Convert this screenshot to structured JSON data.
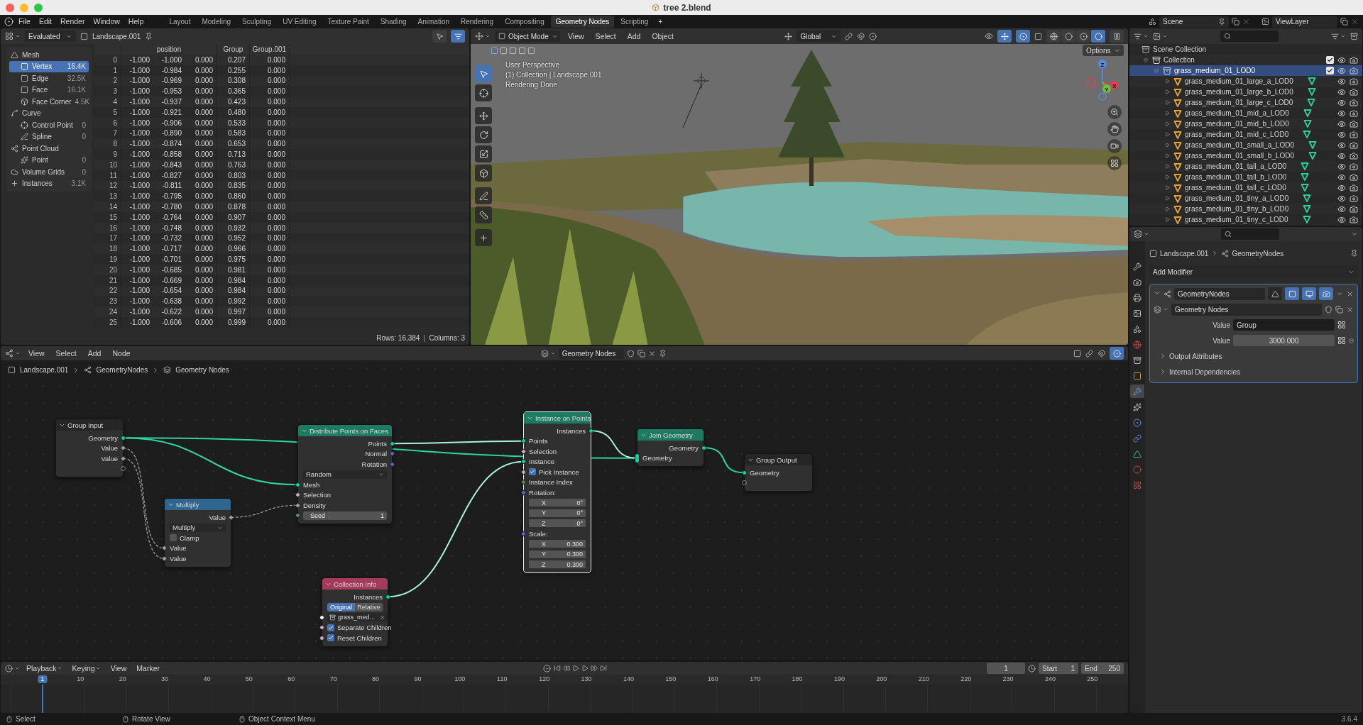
{
  "window": {
    "title": "tree 2.blend"
  },
  "menu": [
    "File",
    "Edit",
    "Render",
    "Window",
    "Help"
  ],
  "workspaces": [
    {
      "label": "Layout",
      "selected": false
    },
    {
      "label": "Modeling",
      "selected": false
    },
    {
      "label": "Sculpting",
      "selected": false
    },
    {
      "label": "UV Editing",
      "selected": false
    },
    {
      "label": "Texture Paint",
      "selected": false
    },
    {
      "label": "Shading",
      "selected": false
    },
    {
      "label": "Animation",
      "selected": false
    },
    {
      "label": "Rendering",
      "selected": false
    },
    {
      "label": "Compositing",
      "selected": false
    },
    {
      "label": "Geometry Nodes",
      "selected": true
    },
    {
      "label": "Scripting",
      "selected": false
    }
  ],
  "add_workspace": "+",
  "scene": "Scene",
  "view_layer": "ViewLayer",
  "spreadsheet": {
    "mode": "Evaluated",
    "object": "Landscape.001",
    "domains": [
      {
        "label": "Mesh",
        "kind": "mesh",
        "children": [
          {
            "label": "Vertex",
            "count": "16.4K",
            "kind": "vertex",
            "selected": true
          },
          {
            "label": "Edge",
            "count": "32.5K",
            "kind": "edge",
            "selected": false
          },
          {
            "label": "Face",
            "count": "16.1K",
            "kind": "face",
            "selected": false
          },
          {
            "label": "Face Corner",
            "count": "4.5K",
            "kind": "corner",
            "selected": false
          }
        ]
      },
      {
        "label": "Curve",
        "kind": "curve",
        "children": [
          {
            "label": "Control Point",
            "count": "0",
            "kind": "point",
            "selected": false
          },
          {
            "label": "Spline",
            "count": "0",
            "kind": "spline",
            "selected": false
          }
        ]
      },
      {
        "label": "Point Cloud",
        "kind": "pointcloud",
        "children": [
          {
            "label": "Point",
            "count": "0",
            "kind": "particle",
            "selected": false
          }
        ]
      },
      {
        "label": "Volume Grids",
        "count": "0",
        "kind": "volume",
        "selected": false
      },
      {
        "label": "Instances",
        "count": "3.1K",
        "kind": "instances",
        "selected": false
      }
    ],
    "columns": [
      {
        "label": "position",
        "kind": "vector"
      },
      {
        "label": "Group",
        "kind": "float"
      },
      {
        "label": "Group.001",
        "kind": "float"
      }
    ],
    "rows": [
      {
        "index": "0",
        "values": [
          [
            "-1.000",
            "-1.000",
            "0.000"
          ],
          "0.207",
          "0.000"
        ]
      },
      {
        "index": "1",
        "values": [
          [
            "-1.000",
            "-0.984",
            "0.000"
          ],
          "0.255",
          "0.000"
        ]
      },
      {
        "index": "2",
        "values": [
          [
            "-1.000",
            "-0.969",
            "0.000"
          ],
          "0.308",
          "0.000"
        ]
      },
      {
        "index": "3",
        "values": [
          [
            "-1.000",
            "-0.953",
            "0.000"
          ],
          "0.365",
          "0.000"
        ]
      },
      {
        "index": "4",
        "values": [
          [
            "-1.000",
            "-0.937",
            "0.000"
          ],
          "0.423",
          "0.000"
        ]
      },
      {
        "index": "5",
        "values": [
          [
            "-1.000",
            "-0.921",
            "0.000"
          ],
          "0.480",
          "0.000"
        ]
      },
      {
        "index": "6",
        "values": [
          [
            "-1.000",
            "-0.906",
            "0.000"
          ],
          "0.533",
          "0.000"
        ]
      },
      {
        "index": "7",
        "values": [
          [
            "-1.000",
            "-0.890",
            "0.000"
          ],
          "0.583",
          "0.000"
        ]
      },
      {
        "index": "8",
        "values": [
          [
            "-1.000",
            "-0.874",
            "0.000"
          ],
          "0.653",
          "0.000"
        ]
      },
      {
        "index": "9",
        "values": [
          [
            "-1.000",
            "-0.858",
            "0.000"
          ],
          "0.713",
          "0.000"
        ]
      },
      {
        "index": "10",
        "values": [
          [
            "-1.000",
            "-0.843",
            "0.000"
          ],
          "0.763",
          "0.000"
        ]
      },
      {
        "index": "11",
        "values": [
          [
            "-1.000",
            "-0.827",
            "0.000"
          ],
          "0.803",
          "0.000"
        ]
      },
      {
        "index": "12",
        "values": [
          [
            "-1.000",
            "-0.811",
            "0.000"
          ],
          "0.835",
          "0.000"
        ]
      },
      {
        "index": "13",
        "values": [
          [
            "-1.000",
            "-0.795",
            "0.000"
          ],
          "0.860",
          "0.000"
        ]
      },
      {
        "index": "14",
        "values": [
          [
            "-1.000",
            "-0.780",
            "0.000"
          ],
          "0.878",
          "0.000"
        ]
      },
      {
        "index": "15",
        "values": [
          [
            "-1.000",
            "-0.764",
            "0.000"
          ],
          "0.907",
          "0.000"
        ]
      },
      {
        "index": "16",
        "values": [
          [
            "-1.000",
            "-0.748",
            "0.000"
          ],
          "0.932",
          "0.000"
        ]
      },
      {
        "index": "17",
        "values": [
          [
            "-1.000",
            "-0.732",
            "0.000"
          ],
          "0.952",
          "0.000"
        ]
      },
      {
        "index": "18",
        "values": [
          [
            "-1.000",
            "-0.717",
            "0.000"
          ],
          "0.966",
          "0.000"
        ]
      },
      {
        "index": "19",
        "values": [
          [
            "-1.000",
            "-0.701",
            "0.000"
          ],
          "0.975",
          "0.000"
        ]
      },
      {
        "index": "20",
        "values": [
          [
            "-1.000",
            "-0.685",
            "0.000"
          ],
          "0.981",
          "0.000"
        ]
      },
      {
        "index": "21",
        "values": [
          [
            "-1.000",
            "-0.669",
            "0.000"
          ],
          "0.984",
          "0.000"
        ]
      },
      {
        "index": "22",
        "values": [
          [
            "-1.000",
            "-0.654",
            "0.000"
          ],
          "0.984",
          "0.000"
        ]
      },
      {
        "index": "23",
        "values": [
          [
            "-1.000",
            "-0.638",
            "0.000"
          ],
          "0.992",
          "0.000"
        ]
      },
      {
        "index": "24",
        "values": [
          [
            "-1.000",
            "-0.622",
            "0.000"
          ],
          "0.997",
          "0.000"
        ]
      },
      {
        "index": "25",
        "values": [
          [
            "-1.000",
            "-0.606",
            "0.000"
          ],
          "0.999",
          "0.000"
        ]
      }
    ],
    "rows_count": "Rows: 16,384",
    "columns_count": "Columns: 3"
  },
  "viewport": {
    "mode": "Object Mode",
    "menus": [
      "View",
      "Select",
      "Add",
      "Object"
    ],
    "orientation": "Global",
    "options": "Options",
    "overlay_text": [
      "User Perspective",
      "(1) Collection | Landscape.001",
      "Rendering Done"
    ],
    "axes": [
      "Z",
      "Y",
      "X"
    ],
    "shading_modes": [
      {
        "selected": false
      },
      {
        "selected": false
      },
      {
        "selected": false
      },
      {
        "selected": true
      }
    ],
    "tools": [
      {
        "selected": true
      },
      {
        "selected": false
      },
      {
        "selected": false
      },
      {
        "selected": false
      },
      {
        "selected": false
      },
      {
        "selected": false
      },
      {
        "selected": false
      },
      {
        "selected": false
      },
      {
        "selected": false
      }
    ]
  },
  "outliner": {
    "tree": [
      {
        "label": "Scene Collection",
        "kind": "scene",
        "selected": false,
        "children": [
          {
            "label": "Collection",
            "kind": "collection",
            "expanded": true,
            "checked": true,
            "selected": false,
            "children": [
              {
                "label": "grass_medium_01_LOD0",
                "kind": "collection",
                "expanded": true,
                "checked": true,
                "selected": true,
                "children": [
                  {
                    "label": "grass_medium_01_large_a_LOD0",
                    "kind": "object",
                    "expanded": false,
                    "selected": false
                  },
                  {
                    "label": "grass_medium_01_large_b_LOD0",
                    "kind": "object",
                    "expanded": false,
                    "selected": false
                  },
                  {
                    "label": "grass_medium_01_large_c_LOD0",
                    "kind": "object",
                    "expanded": false,
                    "selected": false
                  },
                  {
                    "label": "grass_medium_01_mid_a_LOD0",
                    "kind": "object",
                    "expanded": false,
                    "selected": false
                  },
                  {
                    "label": "grass_medium_01_mid_b_LOD0",
                    "kind": "object",
                    "expanded": false,
                    "selected": false
                  },
                  {
                    "label": "grass_medium_01_mid_c_LOD0",
                    "kind": "object",
                    "expanded": false,
                    "selected": false
                  },
                  {
                    "label": "grass_medium_01_small_a_LOD0",
                    "kind": "object",
                    "expanded": false,
                    "selected": false
                  },
                  {
                    "label": "grass_medium_01_small_b_LOD0",
                    "kind": "object",
                    "expanded": false,
                    "selected": false
                  },
                  {
                    "label": "grass_medium_01_tall_a_LOD0",
                    "kind": "object",
                    "expanded": false,
                    "selected": false
                  },
                  {
                    "label": "grass_medium_01_tall_b_LOD0",
                    "kind": "object",
                    "expanded": false,
                    "selected": false
                  },
                  {
                    "label": "grass_medium_01_tall_c_LOD0",
                    "kind": "object",
                    "expanded": false,
                    "selected": false
                  },
                  {
                    "label": "grass_medium_01_tiny_a_LOD0",
                    "kind": "object",
                    "expanded": false,
                    "selected": false
                  },
                  {
                    "label": "grass_medium_01_tiny_b_LOD0",
                    "kind": "object",
                    "expanded": false,
                    "selected": false
                  },
                  {
                    "label": "grass_medium_01_tiny_c_LOD0",
                    "kind": "object",
                    "expanded": false,
                    "selected": false
                  }
                ]
              }
            ]
          }
        ]
      }
    ]
  },
  "properties": {
    "tabs": [
      {
        "selected": false
      },
      {
        "selected": false
      },
      {
        "selected": false
      },
      {
        "selected": false
      },
      {
        "selected": false
      },
      {
        "selected": false
      },
      {
        "selected": false
      },
      {
        "selected": false
      },
      {
        "selected": true
      },
      {
        "selected": false
      },
      {
        "selected": false
      },
      {
        "selected": false
      },
      {
        "selected": false
      },
      {
        "selected": false
      },
      {
        "selected": false
      }
    ],
    "object": "Landscape.001",
    "modifier_path": "GeometryNodes",
    "add_modifier": "Add Modifier",
    "modifier": {
      "name": "GeometryNodes",
      "expanded": true,
      "toggles": [
        {
          "on": false
        },
        {
          "on": true
        },
        {
          "on": true
        },
        {
          "on": true
        }
      ],
      "node_group": "Geometry Nodes",
      "inputs": [
        {
          "label": "Value",
          "value": "Group",
          "kind": "attribute"
        },
        {
          "label": "Value",
          "value": "3000.000",
          "kind": "number"
        }
      ],
      "sections": [
        {
          "label": "Output Attributes",
          "expanded": false
        },
        {
          "label": "Internal Dependencies",
          "expanded": false
        }
      ]
    }
  },
  "node_editor": {
    "menus": [
      "View",
      "Select",
      "Add",
      "Node"
    ],
    "node_group": "Geometry Nodes",
    "breadcrumbs": [
      "Landscape.001",
      "GeometryNodes",
      "Geometry Nodes"
    ],
    "nodes": [
      {
        "title": "Group Input",
        "kind": "group",
        "selected": false,
        "rows": [
          {
            "kind": "output",
            "label": "Geometry",
            "socket": {
              "kind": "geometry"
            }
          },
          {
            "kind": "output",
            "label": "Value",
            "socket": {
              "kind": "float_field"
            }
          },
          {
            "kind": "output",
            "label": "Value",
            "socket": {
              "kind": "float_field"
            }
          },
          {
            "kind": "output_empty",
            "socket": {
              "kind": "virtual"
            }
          }
        ]
      },
      {
        "title": "Multiply",
        "kind": "math",
        "selected": false,
        "rows": [
          {
            "kind": "output",
            "label": "Value",
            "socket": {
              "kind": "float_field"
            }
          },
          {
            "kind": "select",
            "value": "Multiply"
          },
          {
            "kind": "checkbox",
            "label": "Clamp",
            "checked": false
          },
          {
            "kind": "input",
            "label": "Value",
            "socket": {
              "kind": "float_field"
            }
          },
          {
            "kind": "input",
            "label": "Value",
            "socket": {
              "kind": "float_field"
            }
          }
        ]
      },
      {
        "title": "Distribute Points on Faces",
        "kind": "geometry",
        "selected": false,
        "rows": [
          {
            "kind": "output",
            "label": "Points",
            "socket": {
              "kind": "geometry"
            }
          },
          {
            "kind": "output",
            "label": "Normal",
            "socket": {
              "kind": "vector_field"
            }
          },
          {
            "kind": "output",
            "label": "Rotation",
            "socket": {
              "kind": "vector_field"
            }
          },
          {
            "kind": "select",
            "value": "Random"
          },
          {
            "kind": "input",
            "label": "Mesh",
            "socket": {
              "kind": "geometry"
            }
          },
          {
            "kind": "input",
            "label": "Selection",
            "socket": {
              "kind": "bool_field"
            }
          },
          {
            "kind": "input",
            "label": "Density",
            "socket": {
              "kind": "float_field"
            }
          },
          {
            "kind": "number",
            "label": "Seed",
            "value": "1",
            "socket": {
              "kind": "int"
            }
          }
        ]
      },
      {
        "title": "Instance on Points",
        "kind": "geometry",
        "selected": true,
        "rows": [
          {
            "kind": "output",
            "label": "Instances",
            "socket": {
              "kind": "geometry"
            }
          },
          {
            "kind": "input",
            "label": "Points",
            "socket": {
              "kind": "geometry"
            }
          },
          {
            "kind": "input",
            "label": "Selection",
            "socket": {
              "kind": "bool_field"
            }
          },
          {
            "kind": "input",
            "label": "Instance",
            "socket": {
              "kind": "geometry"
            }
          },
          {
            "kind": "checkbox",
            "label": "Pick Instance",
            "checked": true,
            "socket": {
              "kind": "bool_field"
            }
          },
          {
            "kind": "input",
            "label": "Instance Index",
            "socket": {
              "kind": "int_field"
            }
          },
          {
            "kind": "input",
            "label": "Rotation:",
            "socket": {
              "kind": "vector_field"
            }
          },
          {
            "kind": "component",
            "label": "X",
            "value": "0°"
          },
          {
            "kind": "component",
            "label": "Y",
            "value": "0°"
          },
          {
            "kind": "component",
            "label": "Z",
            "value": "0°"
          },
          {
            "kind": "input",
            "label": "Scale:",
            "socket": {
              "kind": "vector_field"
            }
          },
          {
            "kind": "component",
            "label": "X",
            "value": "0.300"
          },
          {
            "kind": "component",
            "label": "Y",
            "value": "0.300"
          },
          {
            "kind": "component",
            "label": "Z",
            "value": "0.300"
          }
        ]
      },
      {
        "title": "Collection Info",
        "kind": "input",
        "selected": false,
        "rows": [
          {
            "kind": "output",
            "label": "Instances",
            "socket": {
              "kind": "geometry"
            }
          },
          {
            "kind": "toggle",
            "options": [
              {
                "label": "Original",
                "selected": true
              },
              {
                "label": "Relative",
                "selected": false
              }
            ]
          },
          {
            "kind": "collection",
            "value": "grass_med...",
            "socket": {
              "kind": "collection"
            }
          },
          {
            "kind": "checkbox",
            "label": "Separate Children",
            "checked": true,
            "socket": {
              "kind": "bool"
            }
          },
          {
            "kind": "checkbox",
            "label": "Reset Children",
            "checked": true,
            "socket": {
              "kind": "bool"
            }
          }
        ]
      },
      {
        "title": "Join Geometry",
        "kind": "geometry",
        "selected": false,
        "rows": [
          {
            "kind": "output",
            "label": "Geometry",
            "socket": {
              "kind": "geometry"
            }
          },
          {
            "kind": "input",
            "label": "Geometry",
            "socket": {
              "kind": "geometry_multi"
            }
          }
        ]
      },
      {
        "title": "Group Output",
        "kind": "group",
        "selected": false,
        "rows": [
          {
            "kind": "input",
            "label": "Geometry",
            "socket": {
              "kind": "geometry"
            }
          },
          {
            "kind": "input_empty",
            "socket": {
              "kind": "virtual"
            }
          }
        ]
      }
    ]
  },
  "timeline": {
    "menus": [
      {
        "label": "Playback",
        "kind": "dropdown"
      },
      {
        "label": "Keying",
        "kind": "dropdown"
      },
      {
        "label": "View",
        "kind": "menu"
      },
      {
        "label": "Marker",
        "kind": "menu"
      }
    ],
    "frame": "1",
    "start_label": "Start",
    "start": "1",
    "end_label": "End",
    "end": "250",
    "ticks": [
      {
        "label": "1",
        "selected": true
      },
      {
        "label": "10",
        "selected": false
      },
      {
        "label": "20",
        "selected": false
      },
      {
        "label": "30",
        "selected": false
      },
      {
        "label": "40",
        "selected": false
      },
      {
        "label": "50",
        "selected": false
      },
      {
        "label": "60",
        "selected": false
      },
      {
        "label": "70",
        "selected": false
      },
      {
        "label": "80",
        "selected": false
      },
      {
        "label": "90",
        "selected": false
      },
      {
        "label": "100",
        "selected": false
      },
      {
        "label": "110",
        "selected": false
      },
      {
        "label": "120",
        "selected": false
      },
      {
        "label": "130",
        "selected": false
      },
      {
        "label": "140",
        "selected": false
      },
      {
        "label": "150",
        "selected": false
      },
      {
        "label": "160",
        "selected": false
      },
      {
        "label": "170",
        "selected": false
      },
      {
        "label": "180",
        "selected": false
      },
      {
        "label": "190",
        "selected": false
      },
      {
        "label": "200",
        "selected": false
      },
      {
        "label": "210",
        "selected": false
      },
      {
        "label": "220",
        "selected": false
      },
      {
        "label": "230",
        "selected": false
      },
      {
        "label": "240",
        "selected": false
      },
      {
        "label": "250",
        "selected": false
      }
    ]
  },
  "status": {
    "items": [
      "Select",
      "Rotate View",
      "Object Context Menu"
    ],
    "version": "3.6.4"
  }
}
